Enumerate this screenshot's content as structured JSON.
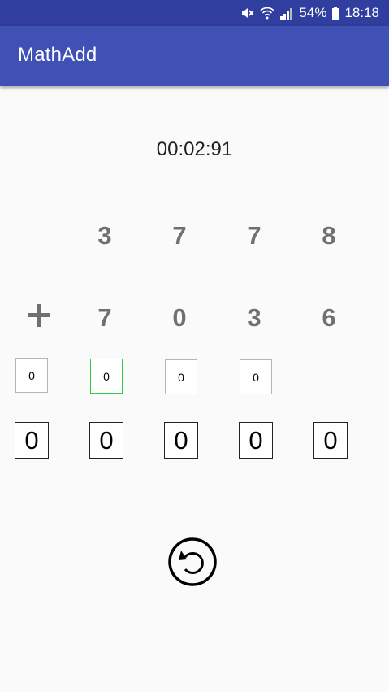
{
  "status_bar": {
    "battery": "54%",
    "time": "18:18",
    "icons": [
      "mute-icon",
      "wifi-icon",
      "signal-icon",
      "battery-icon"
    ]
  },
  "app_bar": {
    "title": "MathAdd"
  },
  "timer": "00:02:91",
  "problem": {
    "top_row": [
      "3",
      "7",
      "7",
      "8"
    ],
    "operator": "plus-icon",
    "bottom_row": [
      "7",
      "0",
      "3",
      "6"
    ]
  },
  "carry_inputs": [
    "0",
    "0",
    "0",
    "0"
  ],
  "active_carry_index": 1,
  "result_inputs": [
    "0",
    "0",
    "0",
    "0",
    "0"
  ],
  "reset_button": {
    "icon": "reset-icon"
  },
  "colors": {
    "status_bar": "#303f9f",
    "app_bar": "#3f51b5",
    "digit": "#707070",
    "active_border": "#2ecc40"
  }
}
